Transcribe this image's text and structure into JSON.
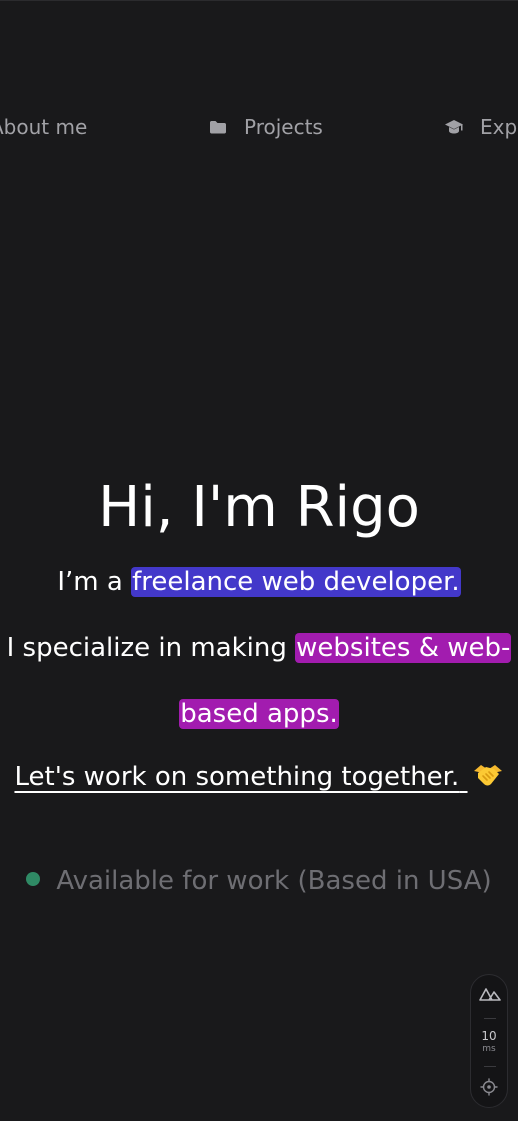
{
  "nav": {
    "items": [
      {
        "label": "About me",
        "icon": "user-icon"
      },
      {
        "label": "Projects",
        "icon": "folder-icon"
      },
      {
        "label": "Experience",
        "icon": "graduation-cap-icon"
      }
    ]
  },
  "hero": {
    "title": "Hi, I'm Rigo",
    "intro_prefix": "I’m a ",
    "intro_highlight": "freelance web developer.",
    "specialize_prefix": "I specialize in making ",
    "specialize_highlight_1": "websites & web-",
    "specialize_highlight_2": "based apps.",
    "cta": "Let's work on something together."
  },
  "status": {
    "text": "Available for work (Based in USA)"
  },
  "devtools": {
    "render_time": "10",
    "render_unit": "ms"
  },
  "colors": {
    "background": "#19191b",
    "highlight_blue": "#4338ca",
    "highlight_purple": "#a21caf",
    "status_dot": "#2f8a65",
    "muted_text": "#6e6e73"
  }
}
